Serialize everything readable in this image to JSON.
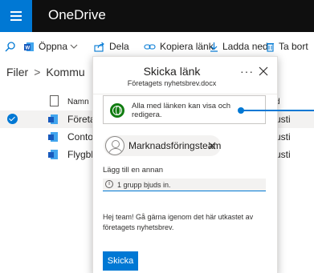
{
  "app": {
    "title": "OneDrive"
  },
  "commands": {
    "open": "Öppna",
    "share": "Dela",
    "copy_link": "Kopiera länk",
    "download": "Ladda ned",
    "delete": "Ta bort"
  },
  "breadcrumb": {
    "root": "Filer",
    "current": "Kommu"
  },
  "list": {
    "header": {
      "name": "Namn",
      "modified": "d"
    },
    "rows": [
      {
        "name": "Företag",
        "modified": "usti",
        "selected": true
      },
      {
        "name": "Contos",
        "modified": "usti"
      },
      {
        "name": "Flygbla",
        "modified": "usti"
      }
    ]
  },
  "dialog": {
    "title": "Skicka länk",
    "subtitle": "Företagets nyhetsbrev.docx",
    "more": "···",
    "permission": "Alla med länken kan visa och redigera.",
    "recipient": "Marknadsföringsteam",
    "add_placeholder": "Lägg till en annan",
    "info": "1 grupp bjuds in.",
    "message": "Hej team! Gå gärna igenom det här utkastet av företagets nyhetsbrev.",
    "send_label": "Skicka"
  },
  "colors": {
    "accent": "#0078d4",
    "appbar": "#0f0f0f",
    "globe": "#107c10"
  }
}
